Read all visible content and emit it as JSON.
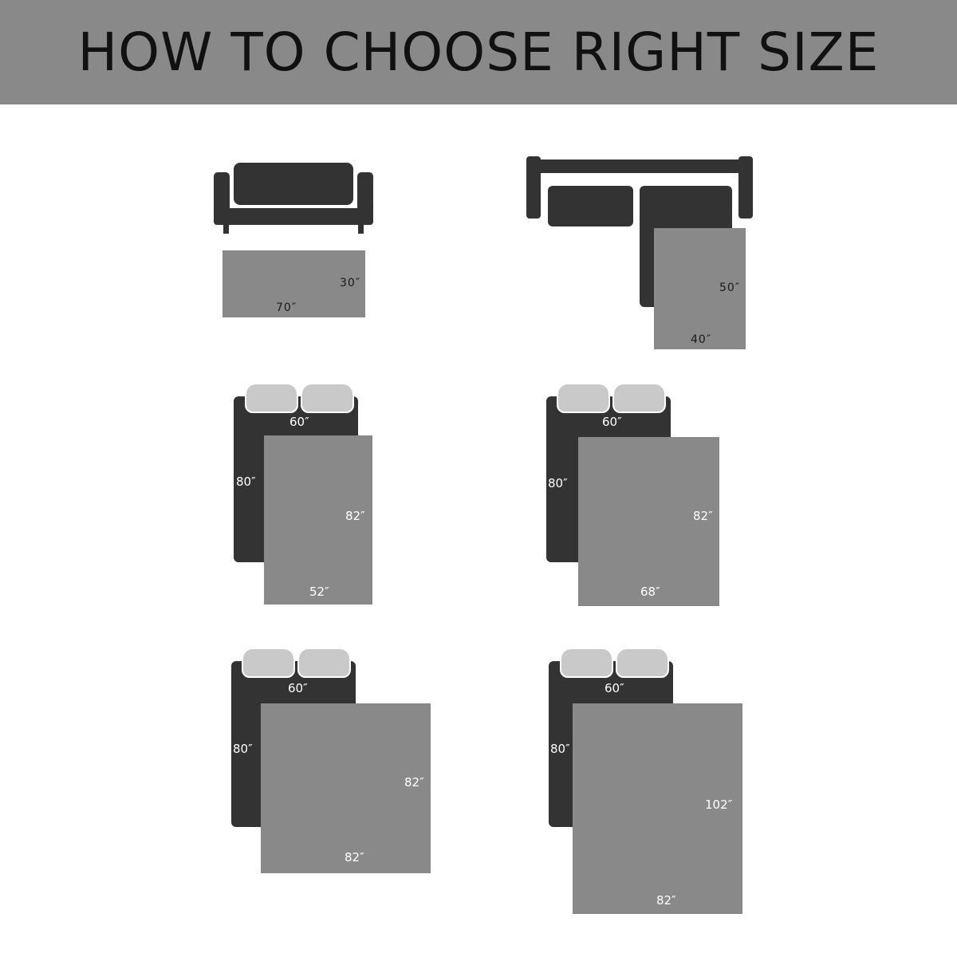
{
  "title": "HOW TO CHOOSE RIGHT SIZE",
  "colors": {
    "header_bg": "#898989",
    "furniture": "#333333",
    "rug": "#898989",
    "pillow": "#c9c9c9"
  },
  "layouts": [
    {
      "furniture": "sofa",
      "rug_height_label": "30″",
      "rug_width_label": "70″"
    },
    {
      "furniture": "sectional-sofa",
      "rug_height_label": "50″",
      "rug_width_label": "40″"
    },
    {
      "furniture": "bed",
      "bed_width_label": "60″",
      "bed_length_label": "80″",
      "rug_height_label": "82″",
      "rug_width_label": "52″"
    },
    {
      "furniture": "bed",
      "bed_width_label": "60″",
      "bed_length_label": "80″",
      "rug_height_label": "82″",
      "rug_width_label": "68″"
    },
    {
      "furniture": "bed",
      "bed_width_label": "60″",
      "bed_length_label": "80″",
      "rug_height_label": "82″",
      "rug_width_label": "82″"
    },
    {
      "furniture": "bed",
      "bed_width_label": "60″",
      "bed_length_label": "80″",
      "rug_height_label": "102″",
      "rug_width_label": "82″"
    }
  ]
}
